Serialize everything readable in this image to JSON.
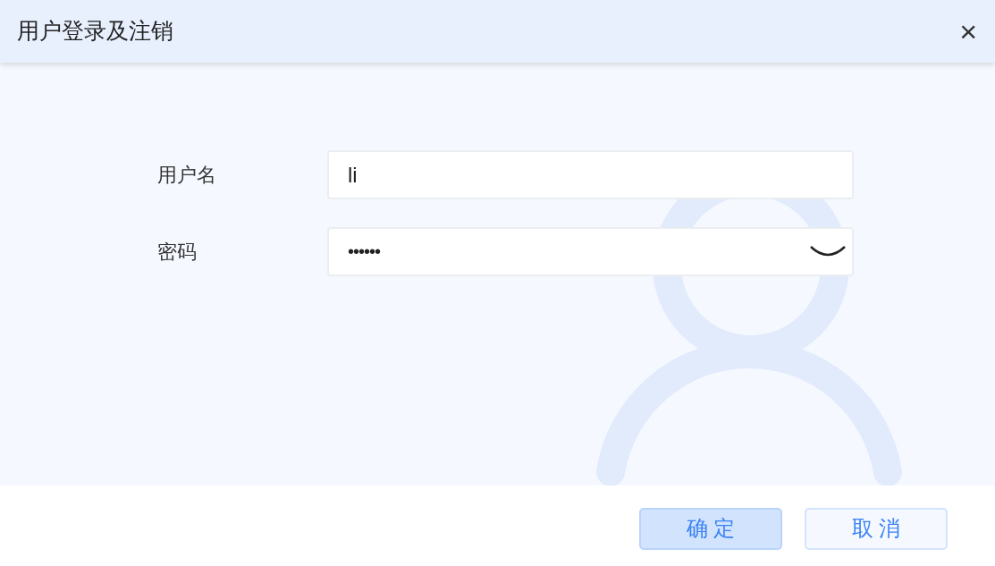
{
  "dialog": {
    "title": "用户登录及注销",
    "close": "×"
  },
  "fields": [
    {
      "label": "用户名",
      "value": "li",
      "kind": "text"
    },
    {
      "label": "密码",
      "value": "••••••",
      "kind": "password"
    }
  ],
  "buttons": [
    {
      "label": "确 定",
      "kind": "primary"
    },
    {
      "label": "取 消",
      "kind": "secondary"
    }
  ]
}
